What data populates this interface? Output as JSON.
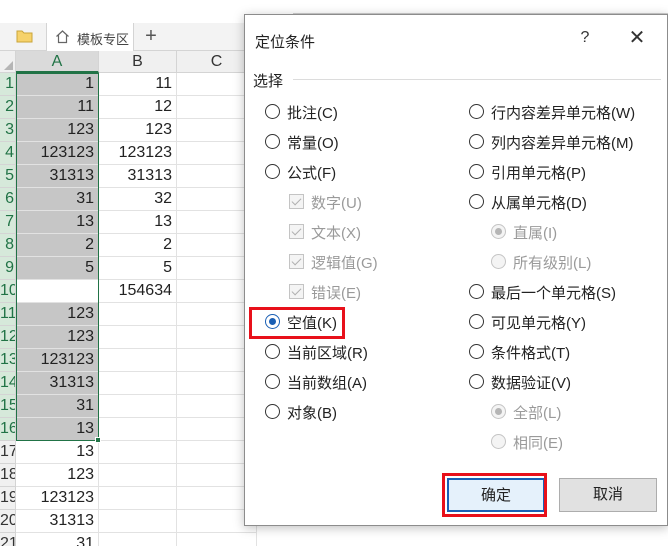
{
  "tabs": {
    "template_label": "模板专区",
    "add_label": "+"
  },
  "columns": [
    "A",
    "B",
    "C"
  ],
  "rows": [
    {
      "num": "1",
      "a": "1",
      "b": "11"
    },
    {
      "num": "2",
      "a": "11",
      "b": "12"
    },
    {
      "num": "3",
      "a": "123",
      "b": "123"
    },
    {
      "num": "4",
      "a": "123123",
      "b": "123123"
    },
    {
      "num": "5",
      "a": "31313",
      "b": "31313"
    },
    {
      "num": "6",
      "a": "31",
      "b": "32"
    },
    {
      "num": "7",
      "a": "13",
      "b": "13"
    },
    {
      "num": "8",
      "a": "2",
      "b": "2"
    },
    {
      "num": "9",
      "a": "5",
      "b": "5"
    },
    {
      "num": "10",
      "a": "",
      "b": "154634"
    },
    {
      "num": "11",
      "a": "123",
      "b": ""
    },
    {
      "num": "12",
      "a": "123",
      "b": ""
    },
    {
      "num": "13",
      "a": "123123",
      "b": ""
    },
    {
      "num": "14",
      "a": "31313",
      "b": ""
    },
    {
      "num": "15",
      "a": "31",
      "b": ""
    },
    {
      "num": "16",
      "a": "13",
      "b": ""
    },
    {
      "num": "17",
      "a": "13",
      "b": ""
    },
    {
      "num": "18",
      "a": "123",
      "b": ""
    },
    {
      "num": "19",
      "a": "123123",
      "b": ""
    },
    {
      "num": "20",
      "a": "31313",
      "b": ""
    },
    {
      "num": "21",
      "a": "31",
      "b": ""
    }
  ],
  "dialog": {
    "title": "定位条件",
    "help": "?",
    "close": "✕",
    "group_label": "选择",
    "left_options": [
      {
        "label": "批注(C)",
        "kind": "radio",
        "checked": false,
        "enabled": true
      },
      {
        "label": "常量(O)",
        "kind": "radio",
        "checked": false,
        "enabled": true
      },
      {
        "label": "公式(F)",
        "kind": "radio",
        "checked": false,
        "enabled": true
      },
      {
        "label": "数字(U)",
        "kind": "check",
        "checked": true,
        "enabled": false
      },
      {
        "label": "文本(X)",
        "kind": "check",
        "checked": true,
        "enabled": false
      },
      {
        "label": "逻辑值(G)",
        "kind": "check",
        "checked": true,
        "enabled": false
      },
      {
        "label": "错误(E)",
        "kind": "check",
        "checked": true,
        "enabled": false
      },
      {
        "label": "空值(K)",
        "kind": "radio",
        "checked": true,
        "enabled": true
      },
      {
        "label": "当前区域(R)",
        "kind": "radio",
        "checked": false,
        "enabled": true
      },
      {
        "label": "当前数组(A)",
        "kind": "radio",
        "checked": false,
        "enabled": true
      },
      {
        "label": "对象(B)",
        "kind": "radio",
        "checked": false,
        "enabled": true
      }
    ],
    "right_options": [
      {
        "label": "行内容差异单元格(W)",
        "kind": "radio",
        "checked": false,
        "enabled": true
      },
      {
        "label": "列内容差异单元格(M)",
        "kind": "radio",
        "checked": false,
        "enabled": true
      },
      {
        "label": "引用单元格(P)",
        "kind": "radio",
        "checked": false,
        "enabled": true
      },
      {
        "label": "从属单元格(D)",
        "kind": "radio",
        "checked": false,
        "enabled": true
      },
      {
        "label": "直属(I)",
        "kind": "radio",
        "checked": true,
        "enabled": false
      },
      {
        "label": "所有级别(L)",
        "kind": "radio",
        "checked": false,
        "enabled": false
      },
      {
        "label": "最后一个单元格(S)",
        "kind": "radio",
        "checked": false,
        "enabled": true
      },
      {
        "label": "可见单元格(Y)",
        "kind": "radio",
        "checked": false,
        "enabled": true
      },
      {
        "label": "条件格式(T)",
        "kind": "radio",
        "checked": false,
        "enabled": true
      },
      {
        "label": "数据验证(V)",
        "kind": "radio",
        "checked": false,
        "enabled": true
      },
      {
        "label": "全部(L)",
        "kind": "radio",
        "checked": true,
        "enabled": false
      },
      {
        "label": "相同(E)",
        "kind": "radio",
        "checked": false,
        "enabled": false
      }
    ],
    "ok_label": "确定",
    "cancel_label": "取消"
  },
  "colors": {
    "highlight": "#e8101a",
    "selection": "#217346",
    "radio_on": "#1a5fb4"
  },
  "icons": {
    "folder": "folder-icon",
    "home": "home-icon"
  }
}
